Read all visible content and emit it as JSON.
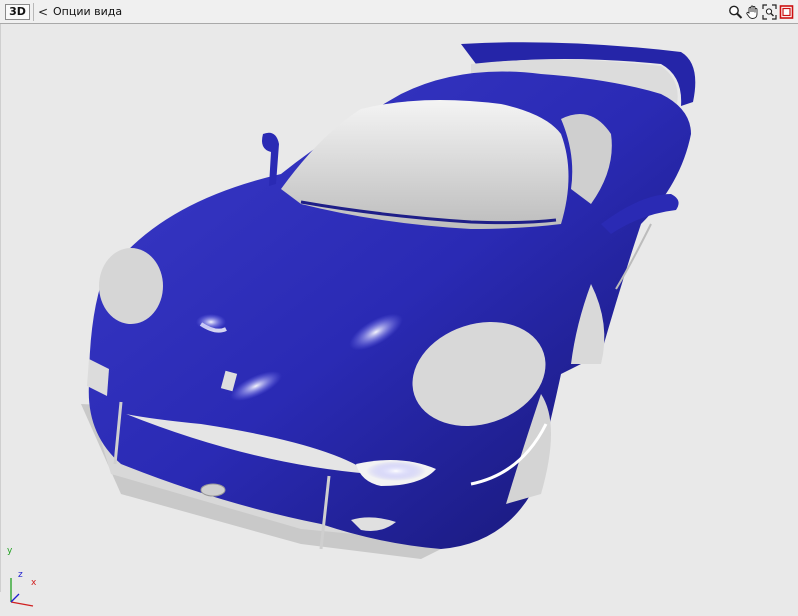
{
  "toolbar": {
    "mode_label": "3D",
    "back_glyph": "<",
    "view_options_label": "Опции вида",
    "tools": [
      {
        "name": "zoom-icon"
      },
      {
        "name": "pan-hand-icon"
      },
      {
        "name": "zoom-extents-icon"
      },
      {
        "name": "maximize-viewport-icon"
      }
    ]
  },
  "viewport": {
    "model_color": "#2a2ab4",
    "background": "#e9e9e9"
  },
  "axis_gizmo": {
    "y_label": "y",
    "z_label": "z",
    "x_label": "x",
    "colors": {
      "x": "#d02020",
      "y": "#20a020",
      "z": "#2020d0"
    }
  }
}
